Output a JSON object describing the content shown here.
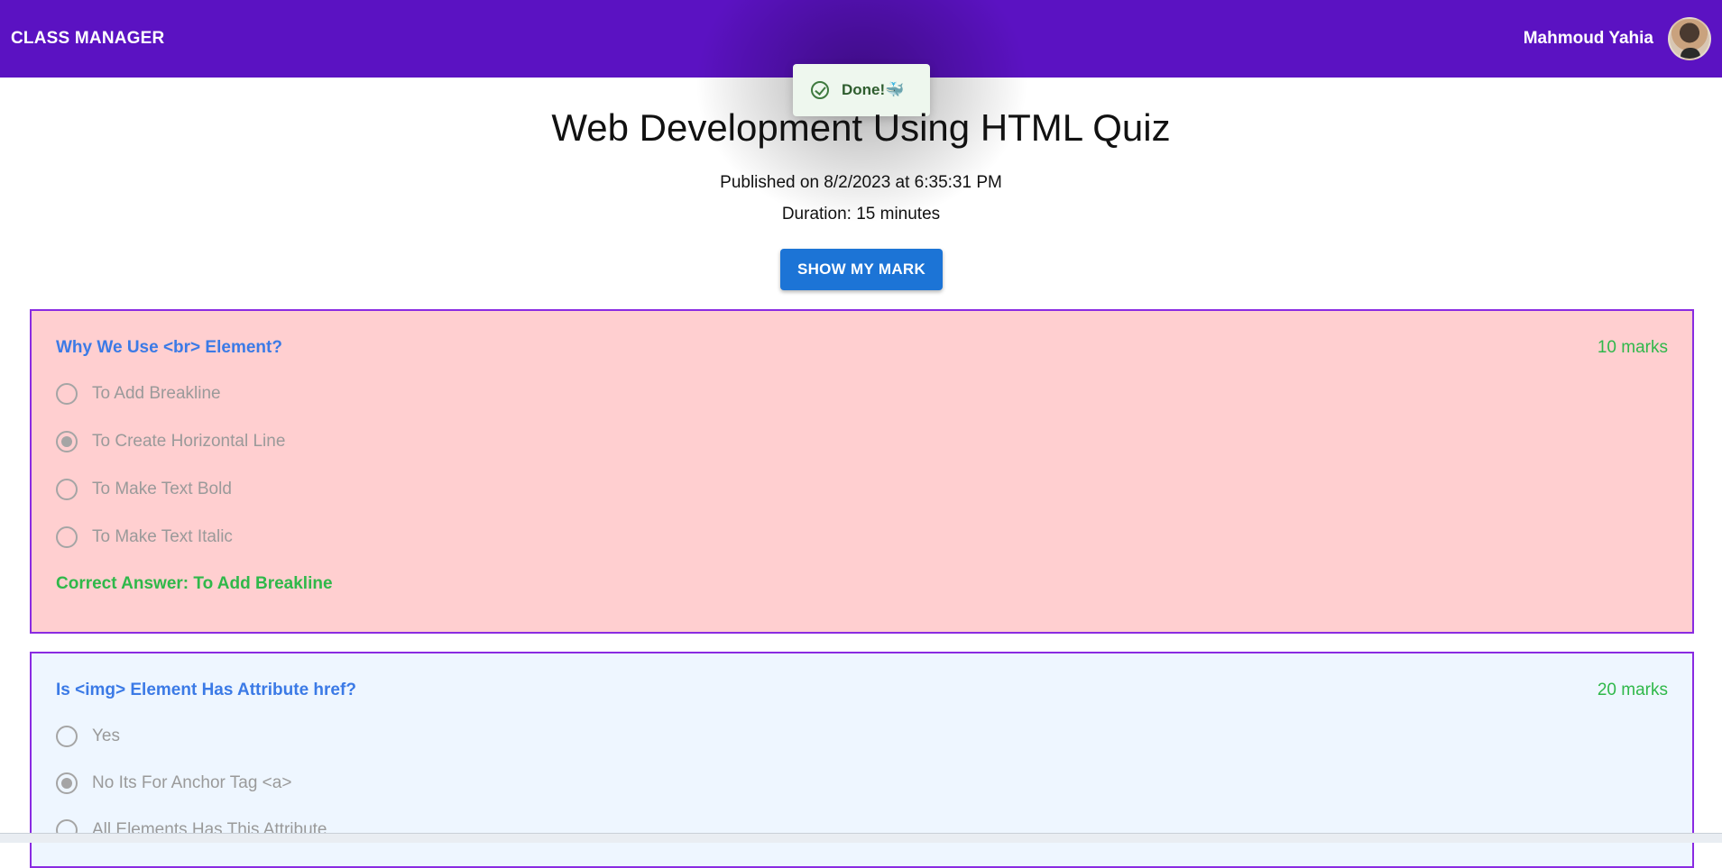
{
  "app": {
    "brand": "CLASS MANAGER",
    "user_name": "Mahmoud Yahia"
  },
  "toast": {
    "text": "Done!🐳",
    "icon": "check-circle-icon"
  },
  "quiz": {
    "title": "Web Development Using HTML Quiz",
    "published": "Published on 8/2/2023 at 6:35:31 PM",
    "duration": "Duration: 15 minutes",
    "show_mark_label": "SHOW MY MARK"
  },
  "questions": [
    {
      "text": "Why We Use <br> Element?",
      "marks": "10 marks",
      "options": [
        "To Add Breakline",
        "To Create Horizontal Line",
        "To Make Text Bold",
        "To Make Text Italic"
      ],
      "selected": "To Create Horizontal Line",
      "correct": "Correct Answer: To Add Breakline",
      "background": "#ffcfd0"
    },
    {
      "text": "Is <img> Element Has Attribute href?",
      "marks": "20 marks",
      "options": [
        "Yes",
        "No Its For Anchor Tag <a>",
        "All Elements Has This Attribute"
      ],
      "selected": "No Its For Anchor Tag <a>",
      "background": "#eef6ff"
    }
  ],
  "colors": {
    "appbar": "#5b12c2",
    "question_title": "#3b7ae6",
    "marks": "#2fb84a",
    "button": "#1c74d6",
    "card_border": "#8a2be2"
  }
}
